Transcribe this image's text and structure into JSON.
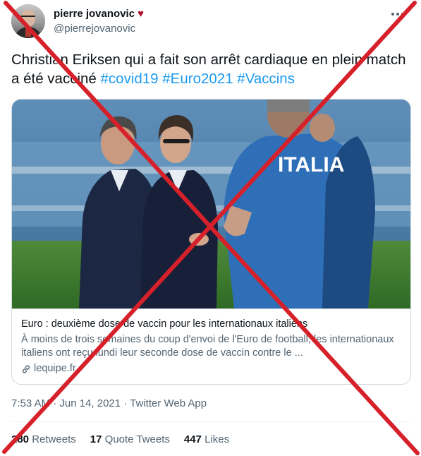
{
  "tweet": {
    "author": {
      "display_name": "pierre jovanovic",
      "emoji": "♥",
      "handle": "@pierrejovanovic"
    },
    "text_plain": "Christian Eriksen qui a fait son arrêt cardiaque en plein match a été vacciné",
    "hashtags": [
      "#covid19",
      "#Euro2021",
      "#Vaccins"
    ],
    "card": {
      "image_shirt_text": "ITALIA",
      "title": "Euro : deuxième dose de vaccin pour les internationaux italiens",
      "description": "À moins de trois semaines du coup d'envoi de l'Euro de football, les internationaux italiens ont reçu lundi leur seconde dose de vaccin contre le ...",
      "source": "lequipe.fr"
    },
    "timestamp": "7:53 AM · Jun 14, 2021 · Twitter Web App",
    "stats": [
      {
        "count": "280",
        "label": "Retweets"
      },
      {
        "count": "17",
        "label": "Quote Tweets"
      },
      {
        "count": "447",
        "label": "Likes"
      }
    ]
  },
  "colors": {
    "hashtag": "#1d9bf0",
    "secondary_text": "#536471",
    "cross_mark": "#d6202a"
  },
  "icons": [
    "more-icon",
    "heart-icon",
    "link-icon"
  ]
}
